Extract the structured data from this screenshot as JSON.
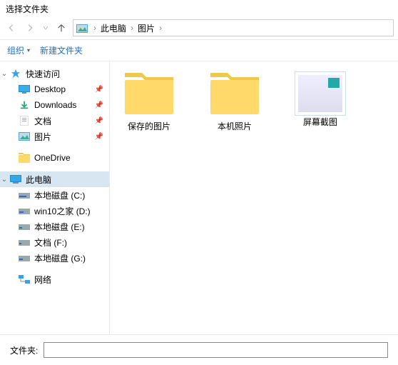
{
  "title": "选择文件夹",
  "breadcrumb": {
    "seg1": "此电脑",
    "seg2": "图片"
  },
  "toolbar": {
    "organize": "组织",
    "newfolder": "新建文件夹"
  },
  "sidebar": {
    "quick": {
      "label": "快速访问",
      "items": [
        {
          "label": "Desktop",
          "pinned": true
        },
        {
          "label": "Downloads",
          "pinned": true
        },
        {
          "label": "文档",
          "pinned": true
        },
        {
          "label": "图片",
          "pinned": true
        }
      ]
    },
    "onedrive": {
      "label": "OneDrive"
    },
    "pc": {
      "label": "此电脑",
      "items": [
        {
          "label": "本地磁盘 (C:)"
        },
        {
          "label": "win10之家 (D:)"
        },
        {
          "label": "本地磁盘 (E:)"
        },
        {
          "label": "文档 (F:)"
        },
        {
          "label": "本地磁盘 (G:)"
        }
      ]
    },
    "network": {
      "label": "网络"
    }
  },
  "folders": [
    {
      "label": "保存的图片",
      "type": "folder"
    },
    {
      "label": "本机照片",
      "type": "folder"
    },
    {
      "label": "屏幕截图",
      "type": "thumb"
    }
  ],
  "footer": {
    "label": "文件夹:",
    "value": ""
  }
}
